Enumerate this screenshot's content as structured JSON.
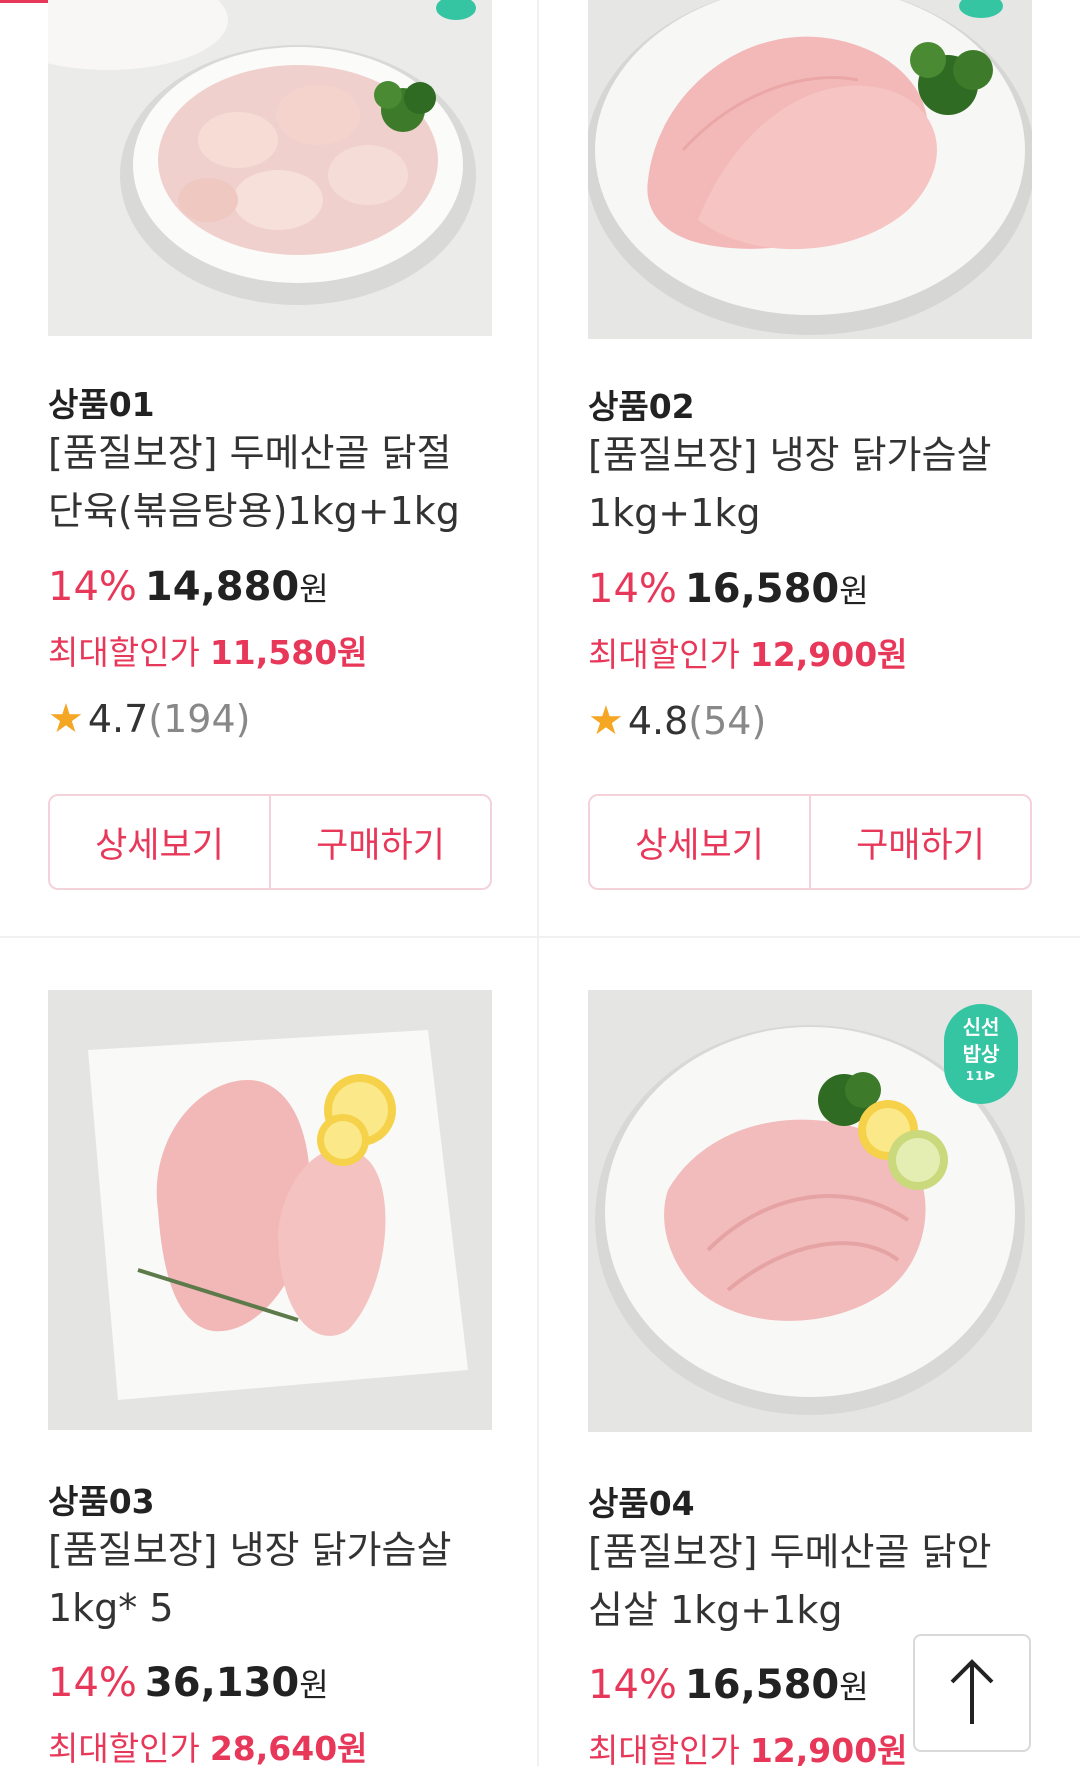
{
  "products": [
    {
      "id": "상품01",
      "name_line1": "[품질보장] 두메산골 닭절",
      "name_line2": "단육(볶음탕용)1kg+1kg",
      "discount": "14%",
      "price": "14,880",
      "won": "원",
      "max_label": "최대할인가",
      "max_price": "11,580원",
      "rating": "4.7",
      "reviews": "(194)",
      "detail_label": "상세보기",
      "buy_label": "구매하기"
    },
    {
      "id": "상품02",
      "name_line1": "[품질보장] 냉장 닭가슴살",
      "name_line2": "1kg+1kg",
      "discount": "14%",
      "price": "16,580",
      "won": "원",
      "max_label": "최대할인가",
      "max_price": "12,900원",
      "rating": "4.8",
      "reviews": "(54)",
      "detail_label": "상세보기",
      "buy_label": "구매하기"
    },
    {
      "id": "상품03",
      "name_line1": "[품질보장] 냉장 닭가슴살",
      "name_line2": "1kg* 5",
      "discount": "14%",
      "price": "36,130",
      "won": "원",
      "max_label": "최대할인가",
      "max_price": "28,640원"
    },
    {
      "id": "상품04",
      "name_line1": "[품질보장] 두메산골 닭안",
      "name_line2": "심살 1kg+1kg",
      "discount": "14%",
      "price": "16,580",
      "won": "원",
      "max_label": "최대할인가",
      "max_price": "12,900원",
      "badge_line1": "신선",
      "badge_line2": "밥상",
      "badge_line3": "11ᐅ"
    }
  ],
  "colors": {
    "accent": "#e8385a",
    "star": "#f5a623",
    "badge": "#35c5a2"
  },
  "icons": {
    "scroll_top": "arrow-up-icon",
    "rating": "star-icon"
  }
}
